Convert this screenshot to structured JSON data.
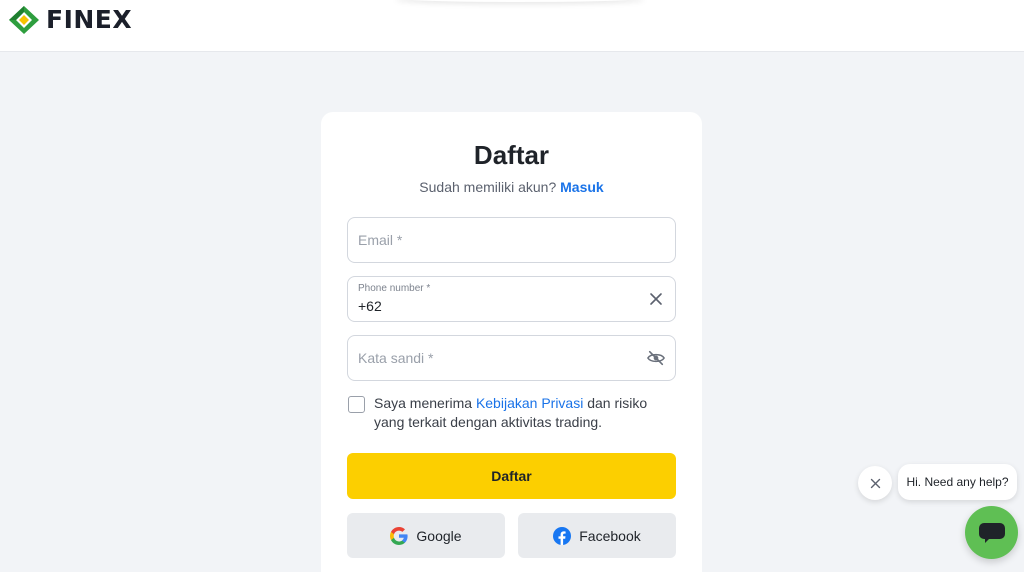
{
  "brand": {
    "name": "FINEX"
  },
  "form": {
    "title": "Daftar",
    "subtitle_prefix": "Sudah memiliki akun?",
    "login_link": "Masuk",
    "email": {
      "placeholder": "Email *",
      "value": ""
    },
    "phone": {
      "label": "Phone number *",
      "value": "+62"
    },
    "password": {
      "placeholder": "Kata sandi *",
      "value": ""
    },
    "consent": {
      "checked": false,
      "text_before": "Saya menerima",
      "link": "Kebijakan Privasi",
      "text_after": "dan risiko yang terkait dengan aktivitas trading."
    },
    "submit_label": "Daftar",
    "social": {
      "google_label": "Google",
      "facebook_label": "Facebook"
    }
  },
  "chat": {
    "prompt": "Hi. Need any help?"
  },
  "colors": {
    "accent_yellow": "#fccf00",
    "link_blue": "#1a73e8",
    "chat_green": "#5fbf54",
    "background": "#f2f4f7",
    "logo_green": "#2e9e3e",
    "logo_yellow": "#f5c400"
  },
  "icons": {
    "phone_clear": "close-icon",
    "password_toggle": "eye-off-icon",
    "chat_close": "close-icon",
    "chat_fab": "chat-icon"
  }
}
